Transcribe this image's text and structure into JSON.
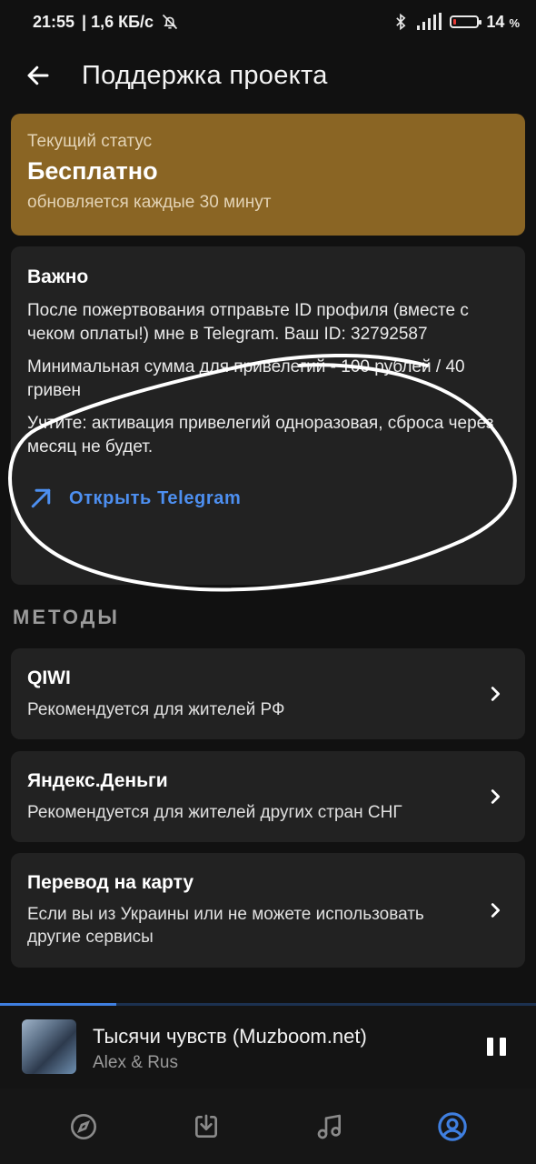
{
  "status_bar": {
    "time": "21:55",
    "net_speed": "| 1,6 КБ/с",
    "battery_percent": "14",
    "battery_unit": "%",
    "icons": [
      "bell-off-icon",
      "bluetooth-icon",
      "signal-icon",
      "battery-icon"
    ]
  },
  "app_bar": {
    "title": "Поддержка проекта",
    "back_icon": "arrow-back-icon"
  },
  "status_card": {
    "label": "Текущий статус",
    "value": "Бесплатно",
    "note": "обновляется каждые 30 минут",
    "color": "#8a6524"
  },
  "important": {
    "title": "Важно",
    "paragraphs": [
      "После пожертвования отправьте ID профиля (вместе с чеком оплаты!) мне в Telegram. Ваш ID: 32792587",
      "Минимальная сумма для привелегий - 100 рублей / 40 гривен",
      "Учтите: активация привелегий одноразовая, сброса через месяц не будет."
    ],
    "link_label": "Открыть Telegram",
    "link_icon": "arrow-up-right-icon",
    "accent_color": "#4d8ff0"
  },
  "methods": {
    "section_title": "МЕТОДЫ",
    "items": [
      {
        "title": "QIWI",
        "subtitle": "Рекомендуется для жителей РФ"
      },
      {
        "title": "Яндекс.Деньги",
        "subtitle": "Рекомендуется для жителей других стран СНГ"
      },
      {
        "title": "Перевод на карту",
        "subtitle": "Если вы из Украины или не можете использовать другие сервисы"
      }
    ]
  },
  "player": {
    "track_title": "Тысячи чувств (Muzboom.net)",
    "artist": "Alex & Rus",
    "progress": 0.217,
    "state": "playing"
  },
  "bottom_nav": {
    "items": [
      {
        "icon": "compass-icon",
        "active": false
      },
      {
        "icon": "download-icon",
        "active": false
      },
      {
        "icon": "music-note-icon",
        "active": false
      },
      {
        "icon": "profile-icon",
        "active": true
      }
    ],
    "active_color": "#3f7fe0"
  }
}
